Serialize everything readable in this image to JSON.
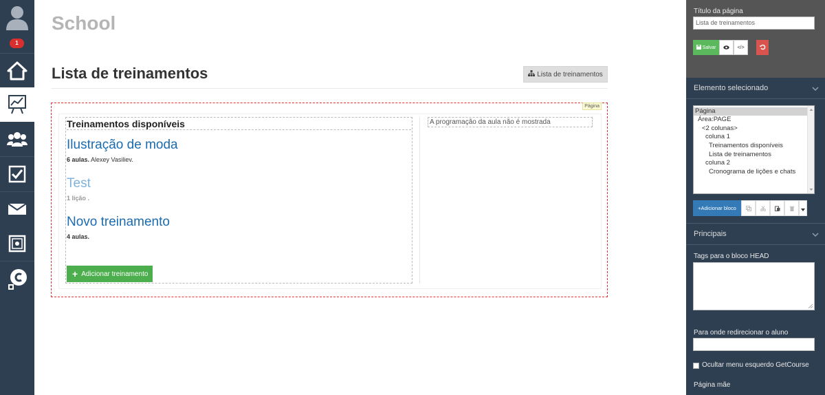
{
  "sidebar": {
    "badge_count": "1",
    "icons": [
      "user-avatar-icon",
      "home-icon",
      "chart-board-icon",
      "users-icon",
      "checkbox-icon",
      "mail-icon",
      "safe-icon",
      "chat-icon"
    ]
  },
  "header": {
    "school_title": "School",
    "page_heading": "Lista de treinamentos",
    "list_button_label": "Lista de treinamentos"
  },
  "canvas": {
    "page_label": "Página",
    "available_title": "Treinamentos disponíveis",
    "trainings": [
      {
        "title": "Ilustração de moda",
        "meta_bold": "6 aulas.",
        "meta_rest": " Alexey Vasiliev.",
        "faded": false
      },
      {
        "title": "Test",
        "meta_bold": "1 lição .",
        "meta_rest": "",
        "faded": true
      },
      {
        "title": "Novo treinamento",
        "meta_bold": "4 aulas.",
        "meta_rest": "",
        "faded": false
      }
    ],
    "add_training_label": "Adicionar treinamento",
    "schedule_note": "A programação da aula não é mostrada"
  },
  "panel": {
    "page_title_label": "Título da página",
    "page_title_value": "Lista de treinamentos",
    "save_label": "Salvar",
    "selected_element_title": "Elemento selecionado",
    "tree": [
      {
        "label": "Página",
        "indent": 0,
        "selected": true
      },
      {
        "label": "Área:PAGE",
        "indent": 1,
        "selected": false
      },
      {
        "label": "<2 colunas>",
        "indent": 2,
        "selected": false
      },
      {
        "label": "coluna 1",
        "indent": 3,
        "selected": false
      },
      {
        "label": "Treinamentos disponíveis",
        "indent": 4,
        "selected": false
      },
      {
        "label": "Lista de treinamentos",
        "indent": 4,
        "selected": false
      },
      {
        "label": "coluna 2",
        "indent": 3,
        "selected": false
      },
      {
        "label": "Cronograma de lições e chats",
        "indent": 4,
        "selected": false
      }
    ],
    "add_block_label": "+Adicionar bloco",
    "principal_title": "Principais",
    "head_tags_label": "Tags para o bloco HEAD",
    "redirect_label": "Para onde redirecionar o aluno",
    "hide_menu_label": "Ocultar menu esquerdo GetCourse",
    "parent_page_label": "Página mãe"
  },
  "colors": {
    "sidebar_bg": "#2f3f52",
    "accent_blue": "#1a6bb0",
    "success_green": "#4cae4c",
    "danger_red": "#d9534f"
  }
}
